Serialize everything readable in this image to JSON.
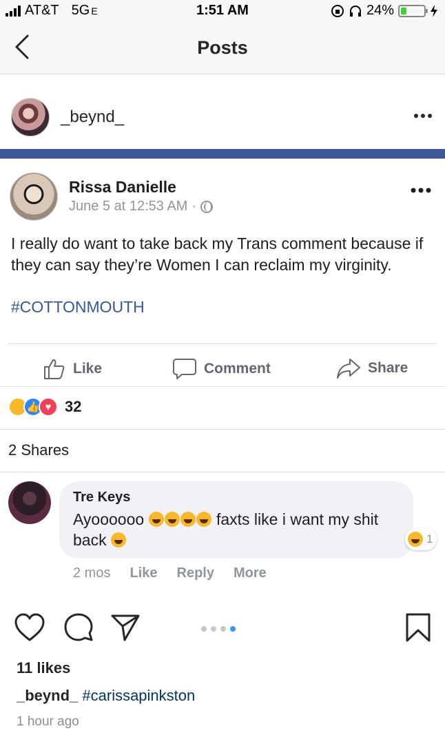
{
  "status_bar": {
    "carrier": "AT&T",
    "network": "5G",
    "network_suffix": "E",
    "time": "1:51 AM",
    "battery_percent": "24%",
    "battery_level": 0.24
  },
  "nav": {
    "title": "Posts"
  },
  "post_header": {
    "username": "_beynd_"
  },
  "fb_post": {
    "author": "Rissa Danielle",
    "timestamp": "June 5 at 12:53 AM",
    "separator": "·",
    "text": "I really do want to take back my Trans comment because if they can say they’re Women I can reclaim my virginity.",
    "hashtag": "#COTTONMOUTH",
    "actions": {
      "like": "Like",
      "comment": "Comment",
      "share": "Share"
    },
    "reaction_count": "32",
    "shares": "2 Shares",
    "comment": {
      "author": "Tre Keys",
      "text_before": "Ayoooooo",
      "text_after": "faxts like i want my shit back",
      "reaction_count": "1",
      "time": "2 mos",
      "like": "Like",
      "reply": "Reply",
      "more": "More"
    }
  },
  "ig_footer": {
    "likes": "11 likes",
    "caption_user": "_beynd_",
    "caption_tag": "#carissapinkston",
    "time_ago": "1 hour ago",
    "carousel_total": 4,
    "carousel_active": 4
  },
  "colors": {
    "fb_blue": "#3b5998",
    "link": "#365899",
    "ig_link": "#003569",
    "carousel_active": "#3897f0"
  },
  "icons": [
    "back-chevron-icon",
    "more-dots-icon",
    "globe-icon",
    "like-thumb-icon",
    "comment-bubble-icon",
    "share-arrow-icon",
    "heart-icon",
    "speech-bubble-icon",
    "send-icon",
    "bookmark-icon"
  ]
}
